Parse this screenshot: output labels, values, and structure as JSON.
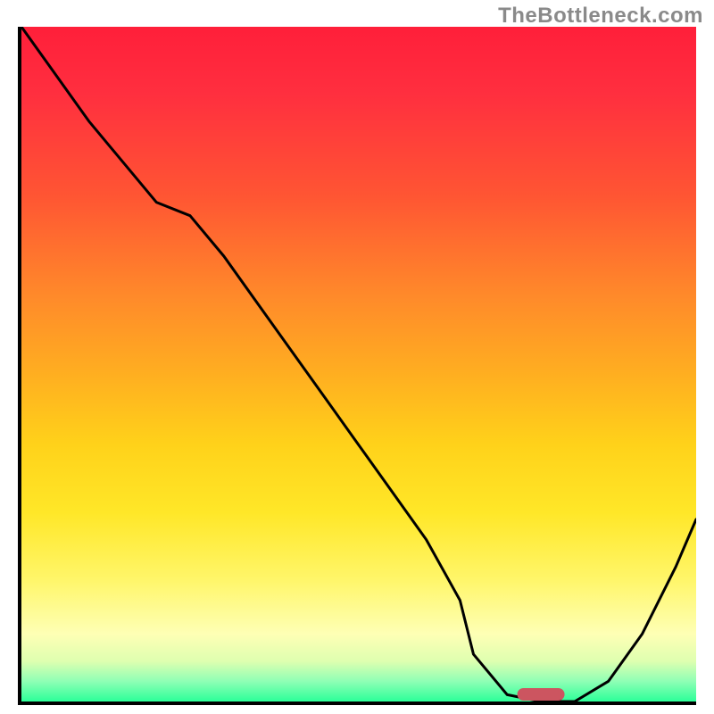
{
  "watermark": "TheBottleneck.com",
  "chart_data": {
    "type": "line",
    "title": "",
    "xlabel": "",
    "ylabel": "",
    "xlim": [
      0,
      100
    ],
    "ylim": [
      0,
      100
    ],
    "x": [
      0,
      5,
      10,
      15,
      20,
      25,
      30,
      35,
      40,
      45,
      50,
      55,
      60,
      65,
      67,
      72,
      77,
      82,
      87,
      92,
      97,
      100
    ],
    "values": [
      100,
      93,
      86,
      80,
      74,
      72,
      66,
      59,
      52,
      45,
      38,
      31,
      24,
      15,
      7,
      1,
      0,
      0,
      3,
      10,
      20,
      27
    ],
    "annotations": [
      {
        "kind": "marker",
        "shape": "pill",
        "x": 77,
        "y": 1,
        "color": "#cc5560",
        "width_pct": 7
      }
    ],
    "background": {
      "type": "vertical-gradient",
      "stops": [
        {
          "pct": 0,
          "color": "#ff1f3a"
        },
        {
          "pct": 25,
          "color": "#ff5533"
        },
        {
          "pct": 52,
          "color": "#ffb020"
        },
        {
          "pct": 72,
          "color": "#ffe728"
        },
        {
          "pct": 90,
          "color": "#feffb5"
        },
        {
          "pct": 100,
          "color": "#2cff99"
        }
      ]
    }
  }
}
